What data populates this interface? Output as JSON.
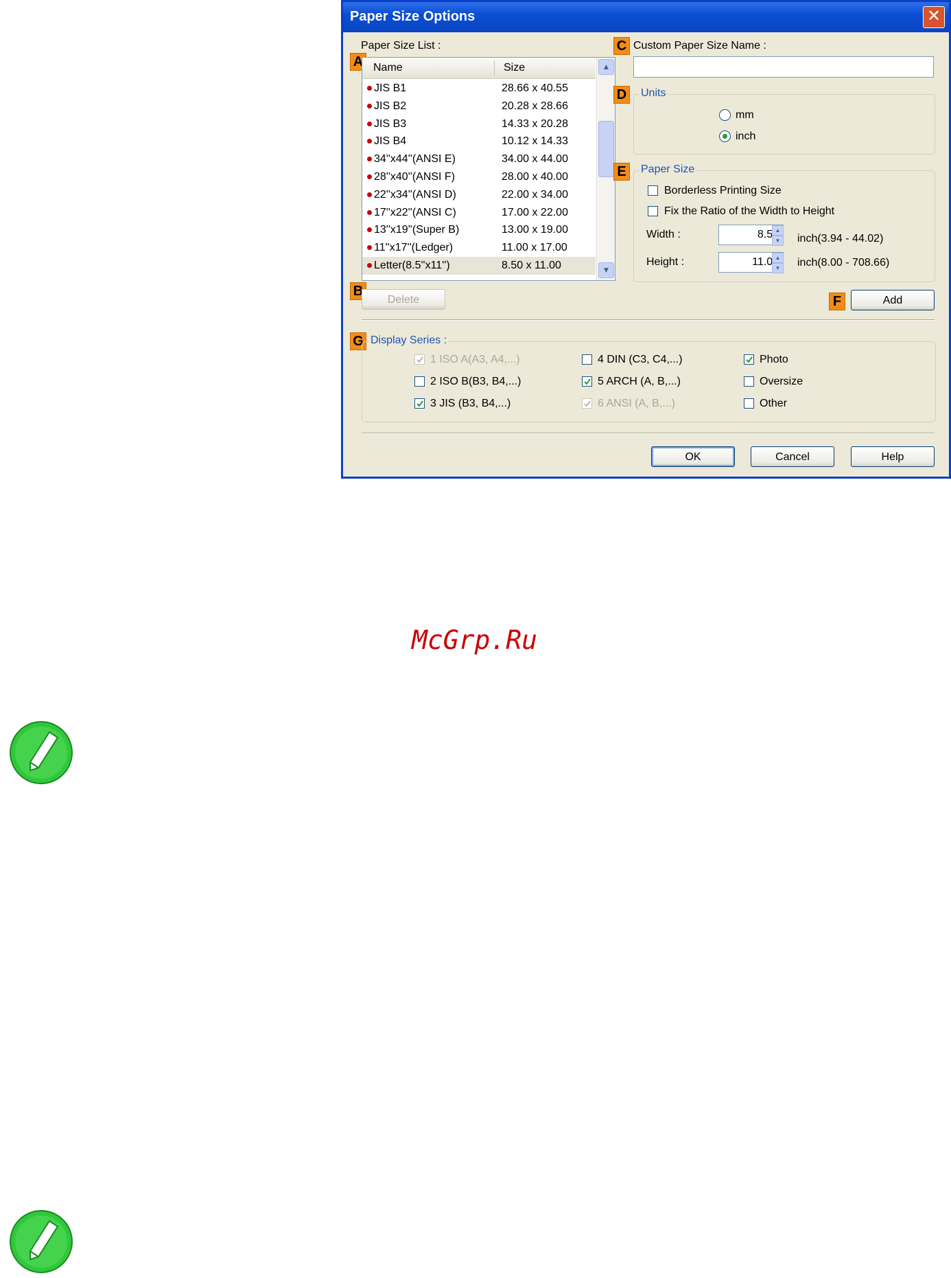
{
  "dialog": {
    "title": "Paper Size Options",
    "paper_size_list_label": "Paper Size List :",
    "list_headers": {
      "name": "Name",
      "size": "Size"
    },
    "list_rows": [
      {
        "name": "JIS B1",
        "size": "28.66 x 40.55"
      },
      {
        "name": "JIS B2",
        "size": "20.28 x 28.66"
      },
      {
        "name": "JIS B3",
        "size": "14.33 x 20.28"
      },
      {
        "name": "JIS B4",
        "size": "10.12 x 14.33"
      },
      {
        "name": "34''x44''(ANSI E)",
        "size": "34.00 x 44.00"
      },
      {
        "name": "28''x40''(ANSI F)",
        "size": "28.00 x 40.00"
      },
      {
        "name": "22''x34''(ANSI D)",
        "size": "22.00 x 34.00"
      },
      {
        "name": "17''x22''(ANSI C)",
        "size": "17.00 x 22.00"
      },
      {
        "name": "13''x19''(Super B)",
        "size": "13.00 x 19.00"
      },
      {
        "name": "11''x17''(Ledger)",
        "size": "11.00 x 17.00"
      },
      {
        "name": "Letter(8.5''x11'')",
        "size": "8.50 x 11.00"
      }
    ],
    "delete_label": "Delete",
    "custom_name_label": "Custom Paper Size Name :",
    "custom_name_value": "",
    "units": {
      "legend": "Units",
      "mm": "mm",
      "inch": "inch",
      "selected": "inch"
    },
    "paper_size": {
      "legend": "Paper Size",
      "borderless": "Borderless Printing Size",
      "fix_ratio": "Fix the Ratio of the Width to Height",
      "width_label": "Width :",
      "width_value": "8.50",
      "width_range": "inch(3.94 - 44.02)",
      "height_label": "Height :",
      "height_value": "11.00",
      "height_range": "inch(8.00 - 708.66)"
    },
    "add_label": "Add",
    "display_series": {
      "legend": "Display Series :",
      "items": [
        {
          "label": "1 ISO A(A3, A4,...)",
          "checked": true,
          "disabled": true
        },
        {
          "label": "2 ISO B(B3, B4,...)",
          "checked": false,
          "disabled": false
        },
        {
          "label": "3 JIS (B3, B4,...)",
          "checked": true,
          "disabled": false
        },
        {
          "label": "4 DIN (C3, C4,...)",
          "checked": false,
          "disabled": false
        },
        {
          "label": "5 ARCH (A, B,...)",
          "checked": true,
          "disabled": false
        },
        {
          "label": "6 ANSI (A, B,...)",
          "checked": true,
          "disabled": true
        },
        {
          "label": "Photo",
          "checked": true,
          "disabled": false
        },
        {
          "label": "Oversize",
          "checked": false,
          "disabled": false
        },
        {
          "label": "Other",
          "checked": false,
          "disabled": false
        }
      ]
    },
    "ok_label": "OK",
    "cancel_label": "Cancel",
    "help_label": "Help",
    "markers": {
      "a": "A",
      "b": "B",
      "c": "C",
      "d": "D",
      "e": "E",
      "f": "F",
      "g": "G"
    }
  },
  "watermark": "McGrp.Ru",
  "colors": {
    "accent": "#f28c19",
    "title_bar": "#0b4ed4",
    "dialog_bg": "#ece9d8",
    "note_icon": "#2fc83a"
  },
  "icons": {
    "note": "pencil-note-icon",
    "close": "close-icon"
  }
}
